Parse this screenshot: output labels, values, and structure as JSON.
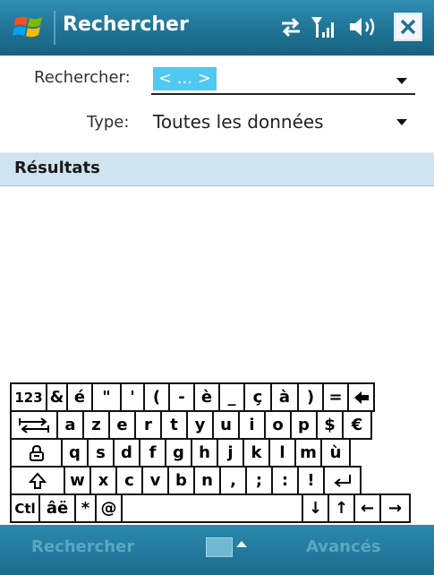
{
  "titlebar": {
    "title": "Rechercher"
  },
  "form": {
    "search_label": "Rechercher:",
    "search_value": "< ... >",
    "type_label": "Type:",
    "type_value": "Toutes les données"
  },
  "results": {
    "header": "Résultats"
  },
  "keyboard": {
    "rows": [
      [
        "123",
        "&",
        "é",
        "\"",
        "'",
        "(",
        "-",
        "è",
        "_",
        "ç",
        "à",
        ")",
        "=",
        "backspace"
      ],
      [
        "tab",
        "a",
        "z",
        "e",
        "r",
        "t",
        "y",
        "u",
        "i",
        "o",
        "p",
        "$",
        "€"
      ],
      [
        "caps",
        "q",
        "s",
        "d",
        "f",
        "g",
        "h",
        "j",
        "k",
        "l",
        "m",
        "ù"
      ],
      [
        "shift",
        "w",
        "x",
        "c",
        "v",
        "b",
        "n",
        ",",
        ";",
        ":",
        "!",
        "enter"
      ],
      [
        "Ctl",
        "âë",
        "*",
        "@",
        "space",
        "↓",
        "↑",
        "←",
        "→"
      ]
    ]
  },
  "menubar": {
    "left_softkey": "Rechercher",
    "right_softkey": "Avancés"
  }
}
